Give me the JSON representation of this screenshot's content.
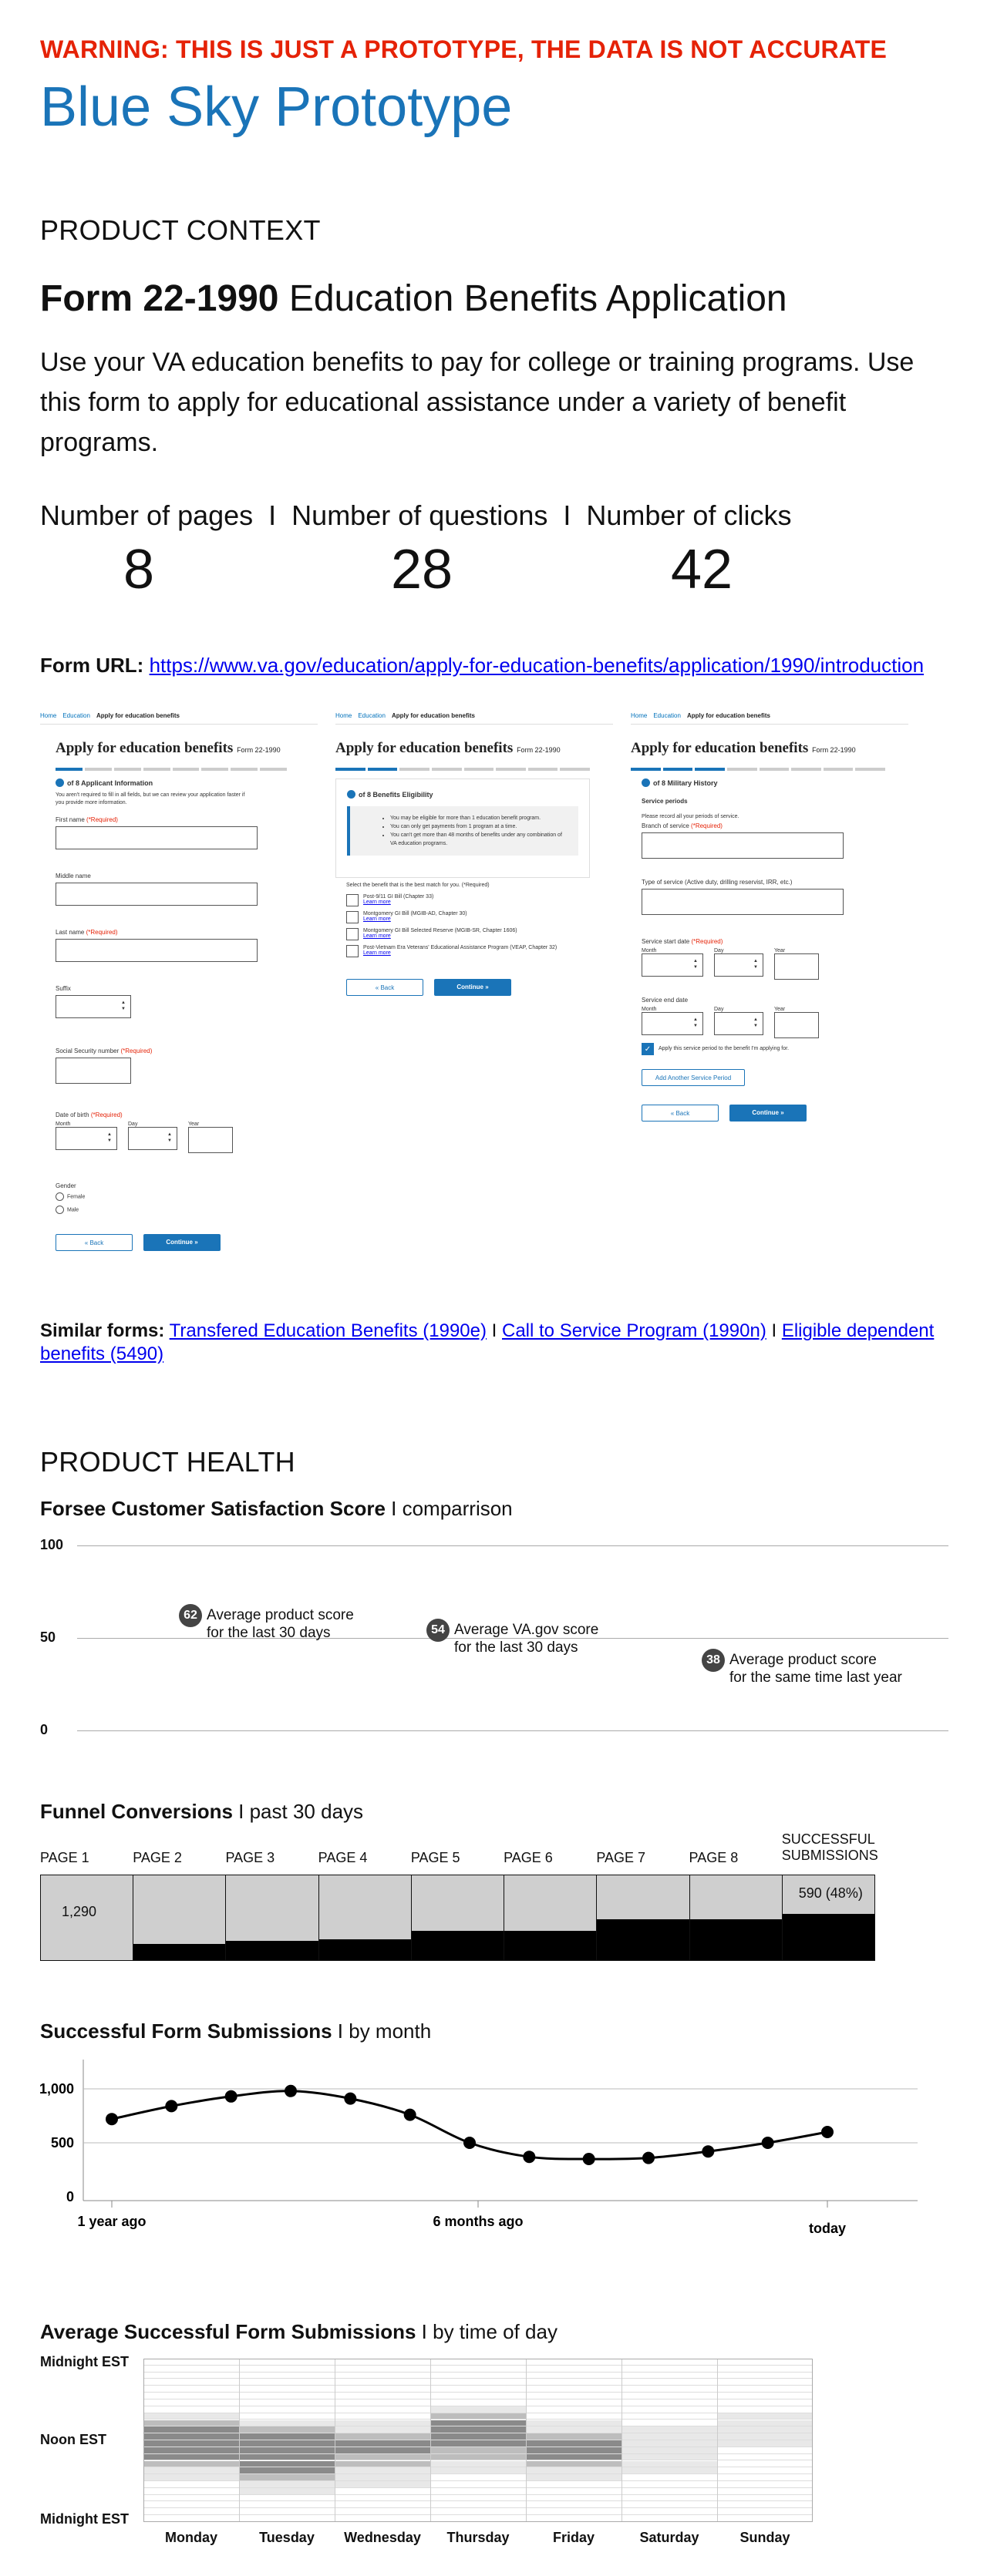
{
  "header": {
    "warning": "WARNING: THIS IS JUST A PROTOTYPE, THE DATA IS NOT ACCURATE",
    "title": "Blue Sky Prototype"
  },
  "product_context": {
    "heading": "PRODUCT CONTEXT",
    "form_number": "Form 22-1990",
    "form_name": "Education Benefits Application",
    "description": "Use your VA education benefits to pay for college or training programs. Use this form to apply for educational assistance under a variety of benefit programs.",
    "metrics_labels": [
      "Number of pages",
      "I",
      "Number of questions",
      "I",
      "Number of clicks"
    ],
    "metrics_values": [
      "8",
      "28",
      "42"
    ],
    "url_label": "Form URL:",
    "url": "https://www.va.gov/education/apply-for-education-benefits/application/1990/introduction"
  },
  "screens": {
    "crumbs": [
      "Home",
      "Education",
      "Apply for education benefits"
    ],
    "app_title": "Apply for education benefits",
    "form_tag": "Form 22-1990",
    "back": "« Back",
    "continue": "Continue »",
    "s1": {
      "step": "of 8  Applicant Information",
      "intro": "You aren't required to fill in all fields, but we can review your application faster if you provide more information.",
      "fields": [
        "First name",
        "Middle name",
        "Last name",
        "Suffix",
        "Social Security number",
        "Date of birth"
      ],
      "required": "(*Required)",
      "month": "Month",
      "day": "Day",
      "year": "Year",
      "gender": "Gender",
      "female": "Female",
      "male": "Male"
    },
    "s2": {
      "step": "of 8  Benefits Eligibility",
      "info": [
        "You may be eligible for more than 1 education benefit program.",
        "You can only get payments from 1 program at a time.",
        "You can't get more than 48 months of benefits under any combination of VA education programs."
      ],
      "question": "Select the benefit that is the best match for you. (*Required)",
      "options": [
        "Post-9/11 GI Bill (Chapter 33)",
        "Montgomery GI Bill (MGIB-AD, Chapter 30)",
        "Montgomery GI Bill Selected Reserve (MGIB-SR, Chapter 1606)",
        "Post-Vietnam Era Veterans' Educational Assistance Program (VEAP, Chapter 32)"
      ],
      "learn": "Learn more"
    },
    "s3": {
      "step": "of 8  Military History",
      "sub": "Service periods",
      "intro": "Please record all your periods of service.",
      "branch": "Branch of service",
      "type": "Type of service (Active duty, drilling reservist, IRR, etc.)",
      "start": "Service start date",
      "end": "Service end date",
      "month": "Month",
      "day": "Day",
      "year": "Year",
      "apply": "Apply this service period to the benefit I'm applying for.",
      "add": "Add Another Service Period",
      "required": "(*Required)"
    }
  },
  "similar": {
    "label": "Similar forms:",
    "sep": "I",
    "links": [
      "Transfered Education Benefits (1990e)",
      "Call to Service Program (1990n)",
      "Eligible dependent benefits (5490)"
    ]
  },
  "product_health": {
    "heading": "PRODUCT HEALTH"
  },
  "csat": {
    "title_bold": "Forsee Customer Satisfaction Score",
    "title_rest": " I comparrison",
    "ticks": [
      "100",
      "50",
      "0"
    ],
    "ylim": [
      0,
      100
    ],
    "points": [
      {
        "value": 62,
        "line1": "Average product score",
        "line2": "for the last 30 days"
      },
      {
        "value": 54,
        "line1": "Average VA.gov score",
        "line2": "for the last 30 days"
      },
      {
        "value": 38,
        "line1": "Average product score",
        "line2": "for the same time last year"
      }
    ]
  },
  "funnel": {
    "title_bold": "Funnel Conversions",
    "title_rest": " I past 30 days",
    "labels": [
      "PAGE 1",
      "PAGE 2",
      "PAGE 3",
      "PAGE 4",
      "PAGE 5",
      "PAGE 6",
      "PAGE 7",
      "PAGE 8",
      "SUCCESSFUL SUBMISSIONS"
    ],
    "first_value": "1,290",
    "last_value": "590 (48%)",
    "dark_fraction": [
      0.0,
      0.19,
      0.23,
      0.25,
      0.35,
      0.35,
      0.48,
      0.48,
      0.55
    ]
  },
  "chart_data": {
    "type": "line",
    "title": "Successful Form Submissions",
    "subtitle": " I by month",
    "ylim": [
      0,
      1200
    ],
    "yticks": [
      "1,000",
      "500",
      "0"
    ],
    "ytick_values": [
      1000,
      500,
      0
    ],
    "xlabels": [
      "1 year ago",
      "6 months ago",
      "today"
    ],
    "values": [
      720,
      840,
      930,
      980,
      910,
      760,
      500,
      370,
      350,
      360,
      420,
      500,
      600
    ]
  },
  "heatmap": {
    "title_bold": "Average Successful Form Submissions",
    "title_rest": " I by time of day",
    "ylabels": [
      "Midnight EST",
      "Noon EST",
      "Midnight EST"
    ],
    "days": [
      "Monday",
      "Tuesday",
      "Wednesday",
      "Thursday",
      "Friday",
      "Saturday",
      "Sunday"
    ],
    "intensity": [
      [
        0,
        0,
        0,
        0,
        0,
        0,
        0,
        0,
        1,
        2,
        3,
        3,
        3,
        3,
        3,
        2,
        1,
        1,
        0,
        0,
        0,
        0,
        0,
        0
      ],
      [
        0,
        0,
        0,
        0,
        0,
        0,
        0,
        0,
        0,
        1,
        2,
        3,
        3,
        3,
        3,
        3,
        3,
        2,
        1,
        1,
        0,
        0,
        0,
        0
      ],
      [
        0,
        0,
        0,
        0,
        0,
        0,
        0,
        0,
        0,
        1,
        1,
        2,
        3,
        3,
        2,
        2,
        1,
        1,
        1,
        0,
        0,
        0,
        0,
        0
      ],
      [
        0,
        0,
        0,
        0,
        0,
        0,
        0,
        1,
        2,
        3,
        3,
        3,
        3,
        2,
        2,
        1,
        1,
        0,
        0,
        0,
        0,
        0,
        0,
        0
      ],
      [
        0,
        0,
        0,
        0,
        0,
        0,
        0,
        0,
        0,
        1,
        1,
        2,
        3,
        3,
        3,
        2,
        1,
        1,
        0,
        0,
        0,
        0,
        0,
        0
      ],
      [
        0,
        0,
        0,
        0,
        0,
        0,
        0,
        0,
        0,
        0,
        1,
        1,
        1,
        1,
        1,
        1,
        1,
        0,
        0,
        0,
        0,
        0,
        0,
        0
      ],
      [
        0,
        0,
        0,
        0,
        0,
        0,
        0,
        0,
        1,
        1,
        1,
        1,
        1,
        0,
        0,
        0,
        0,
        0,
        0,
        0,
        0,
        0,
        0,
        0
      ]
    ]
  }
}
